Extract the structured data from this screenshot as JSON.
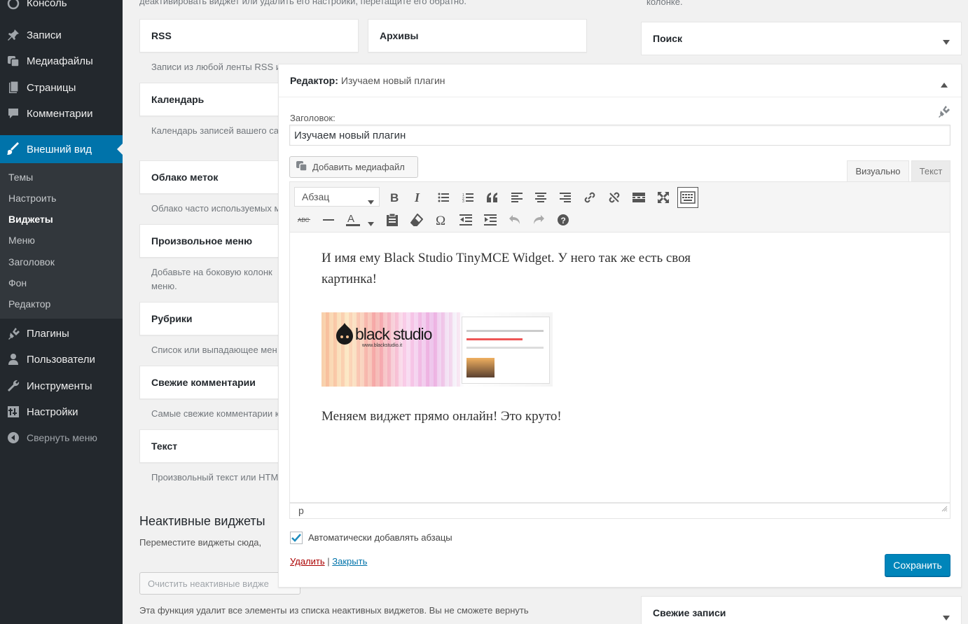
{
  "sidebar": {
    "items": [
      {
        "label": "Консоль",
        "icon": "dashboard-icon"
      },
      {
        "label": "Записи",
        "icon": "pin-icon"
      },
      {
        "label": "Медиафайлы",
        "icon": "media-icon"
      },
      {
        "label": "Страницы",
        "icon": "pages-icon"
      },
      {
        "label": "Комментарии",
        "icon": "comments-icon"
      },
      {
        "label": "Внешний вид",
        "icon": "brush-icon"
      },
      {
        "label": "Плагины",
        "icon": "plugin-icon"
      },
      {
        "label": "Пользователи",
        "icon": "user-icon"
      },
      {
        "label": "Инструменты",
        "icon": "wrench-icon"
      },
      {
        "label": "Настройки",
        "icon": "settings-icon"
      }
    ],
    "submenu": [
      "Темы",
      "Настроить",
      "Виджеты",
      "Меню",
      "Заголовок",
      "Фон",
      "Редактор"
    ],
    "collapse": "Свернуть меню"
  },
  "widgets": {
    "top_hint": "деактивировать виджет или удалить его настройки, перетащите его обратно.",
    "rss": "RSS",
    "archives": "Архивы",
    "rss_desc": "Записи из любой ленты RSS и",
    "calendar": "Календарь",
    "calendar_desc": "Календарь записей вашего са",
    "tag_cloud": "Облако меток",
    "tag_cloud_desc": "Облако часто используемых м",
    "custom_menu": "Произвольное меню",
    "custom_menu_desc_1": "Добавьте на боковую колонк",
    "custom_menu_desc_2": "меню.",
    "categories": "Рубрики",
    "categories_desc": "Список или выпадающее мен",
    "recent_comments": "Свежие комментарии",
    "recent_comments_desc": "Самые свежие комментарии к",
    "text": "Текст",
    "text_desc": "Произвольный текст или HTM",
    "inactive_title": "Неактивные виджеты",
    "inactive_desc": "Переместите виджеты сюда,",
    "clear_inactive": "Очистить неактивные видже",
    "clear_desc": "Эта функция удалит все элементы из списка неактивных виджетов. Вы не сможете вернуть"
  },
  "right": {
    "top_text": "колонке.",
    "search": "Поиск",
    "recent_posts": "Свежие записи"
  },
  "editor": {
    "header_label": "Редактор:",
    "header_title": "Изучаем новый плагин",
    "title_label": "Заголовок:",
    "title_value": "Изучаем новый плагин",
    "add_media": "Добавить медиафайл",
    "tab_visual": "Визуально",
    "tab_text": "Текст",
    "format_select": "Абзац",
    "content_line1": "И имя ему Black Studio TinyMCE Widget. У него так же есть своя",
    "content_line2": "картинка!",
    "image_logo": "black studio",
    "image_url": "www.blackstudio.it",
    "content_line3": "Меняем виджет прямо онлайн! Это круто!",
    "path": "p",
    "autop_label": "Автоматически добавлять абзацы",
    "delete": "Удалить",
    "separator": "|",
    "close": "Закрыть",
    "save": "Сохранить"
  },
  "colors": {
    "sidebar_bg": "#23282d",
    "active": "#0073aa",
    "save_button": "#0085ba",
    "delete_link": "#a00",
    "link": "#0073aa"
  }
}
